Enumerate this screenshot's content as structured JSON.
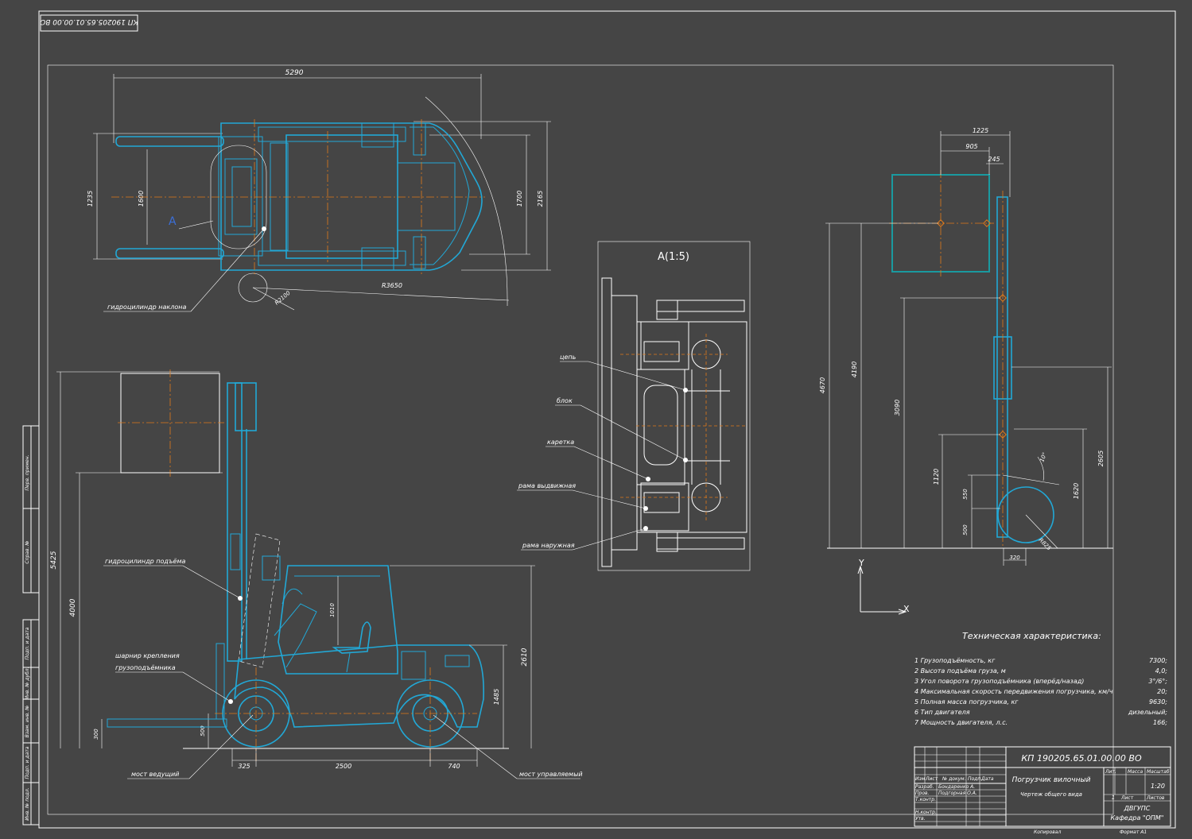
{
  "stamp_code": "КП 190205.65.01.00.00 ВО",
  "top_view": {
    "dim_length": "5290",
    "dim_left_outer": "1235",
    "dim_left_inner": "1600",
    "dim_right_inner": "1700",
    "dim_right_outer": "2165",
    "dim_radius_big": "R3650",
    "dim_radius_small": "R2100",
    "view_marker": "A",
    "label_tilt_cylinder": "гидроцилиндр наклона"
  },
  "side_view": {
    "dim_total_height": "5425",
    "dim_lift_height": "4000",
    "dim_cab_upper": "1010",
    "dim_cab_height": "2610",
    "dim_mid": "1485",
    "dim_fork_300": "300",
    "dim_fork_500": "500",
    "dim_front": "325",
    "dim_wheelbase": "2500",
    "dim_rear": "740",
    "label_lift_cylinder": "гидроцилиндр подъёма",
    "label_hinge_1": "шарнир крепления",
    "label_hinge_2": "грузоподъёмника",
    "label_drive_axle": "мост ведущий",
    "label_steer_axle": "мост управляемый"
  },
  "detail_view": {
    "title": "A(1:5)",
    "labels": [
      "цепь",
      "блок",
      "каретка",
      "рама выдвижная",
      "рама наружная"
    ]
  },
  "right_view": {
    "dim_1225": "1225",
    "dim_905": "905",
    "dim_245": "245",
    "dim_4670": "4670",
    "dim_4190": "4190",
    "dim_3090": "3090",
    "dim_1120": "1120",
    "dim_550": "550",
    "dim_500": "500",
    "dim_2605": "2605",
    "dim_1620": "1620",
    "dim_320": "320",
    "dim_r825": "R825",
    "dim_angle": "10°"
  },
  "axes": {
    "x": "X",
    "y": "Y"
  },
  "specs": {
    "title": "Техническая характеристика:",
    "rows": [
      {
        "label": "1  Грузоподъёмность, кг",
        "value": "7300;"
      },
      {
        "label": "2  Высота подъёма груза, м",
        "value": "4,0;"
      },
      {
        "label": "3  Угол поворота грузоподъёмника (вперёд/назад)",
        "value": "3°/6°;"
      },
      {
        "label": "4  Максимальная скорость передвижения погрузчика, км/ч",
        "value": "20;"
      },
      {
        "label": "5  Полная масса погрузчика, кг",
        "value": "9630;"
      },
      {
        "label": "6  Тип двигателя",
        "value": "дизельный;"
      },
      {
        "label": "7  Мощность двигателя, л.с.",
        "value": "166;"
      }
    ]
  },
  "title_block": {
    "code": "КП 190205.65.01.00.00 ВО",
    "name": "Погрузчик вилочный",
    "subname": "Чертеж общего вида",
    "scale": "1:20",
    "org1": "ДВГУПС",
    "org2": "Кафедра \"ОПМ\"",
    "sheet": "1",
    "copied": "Копировал",
    "format": "Формат  А1",
    "col_headers": [
      "Изм",
      "Лист",
      "№ докум.",
      "Подп.",
      "Дата"
    ],
    "role_rows": [
      "Разраб.",
      "Пров.",
      "Т.контр.",
      "",
      "Н.контр.",
      "Утв."
    ],
    "names": [
      "Бондаренко А.",
      "Подгорная О.А."
    ],
    "lit_headers": [
      "Лит.",
      "Масса",
      "Масштаб"
    ],
    "sheet_headers": [
      "Лист",
      "Листов"
    ]
  },
  "side_strip": [
    "Перв. примен.",
    "Справ. №",
    "Подп. и дата",
    "Инв. № дубл.",
    "Взам. инв. №",
    "Подп. и дата",
    "Инв. № подл."
  ]
}
